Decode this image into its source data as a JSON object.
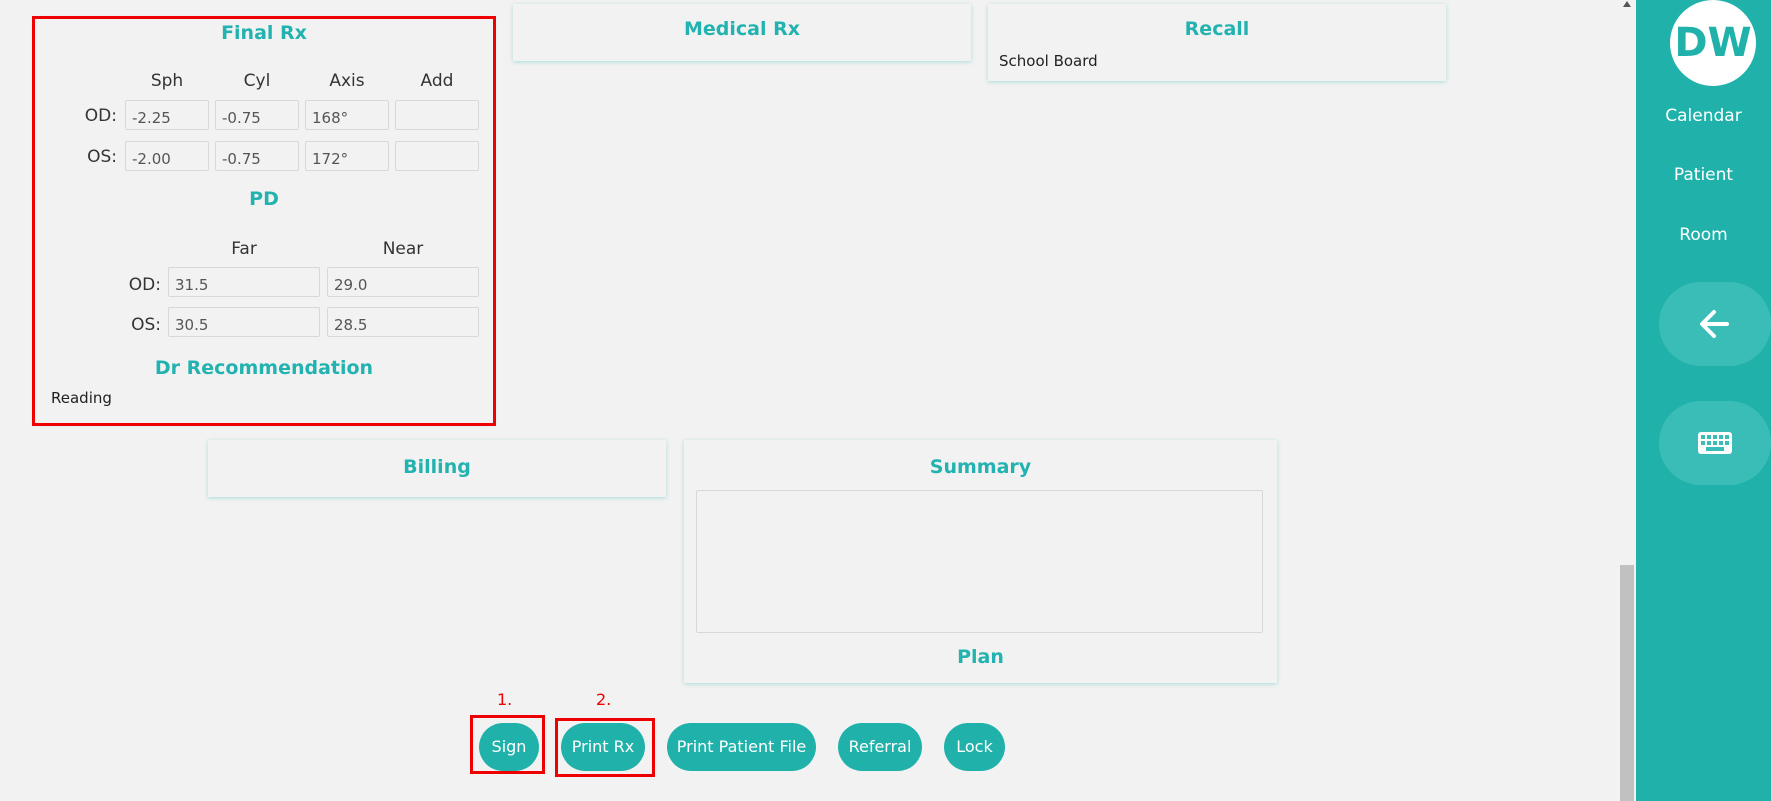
{
  "final_rx": {
    "title": "Final Rx",
    "col_sph": "Sph",
    "col_cyl": "Cyl",
    "col_axis": "Axis",
    "col_add": "Add",
    "od_label": "OD:",
    "os_label": "OS:",
    "od": {
      "sph": "-2.25",
      "cyl": "-0.75",
      "axis": "168°",
      "add": ""
    },
    "os": {
      "sph": "-2.00",
      "cyl": "-0.75",
      "axis": "172°",
      "add": ""
    },
    "pd_title": "PD",
    "col_far": "Far",
    "col_near": "Near",
    "pd_od": {
      "far": "31.5",
      "near": "29.0"
    },
    "pd_os": {
      "far": "30.5",
      "near": "28.5"
    },
    "rec_title": "Dr Recommendation",
    "rec_value": "Reading"
  },
  "medical_rx": {
    "title": "Medical Rx"
  },
  "recall": {
    "title": "Recall",
    "value": "School Board"
  },
  "billing": {
    "title": "Billing"
  },
  "summary": {
    "title": "Summary",
    "text": "",
    "plan_label": "Plan"
  },
  "actions": {
    "sign": "Sign",
    "print_rx": "Print Rx",
    "print_patient_file": "Print Patient File",
    "referral": "Referral",
    "lock": "Lock",
    "marker_1": "1.",
    "marker_2": "2."
  },
  "sidebar": {
    "avatar_initials": "DW",
    "items": [
      "Calendar",
      "Patient",
      "Room"
    ],
    "back_icon": "arrow-left-icon",
    "keyboard_icon": "keyboard-icon"
  },
  "colors": {
    "accent": "#20b2aa",
    "title": "#22b3b0",
    "highlight": "#ee0000",
    "background": "#f2f2f2"
  }
}
